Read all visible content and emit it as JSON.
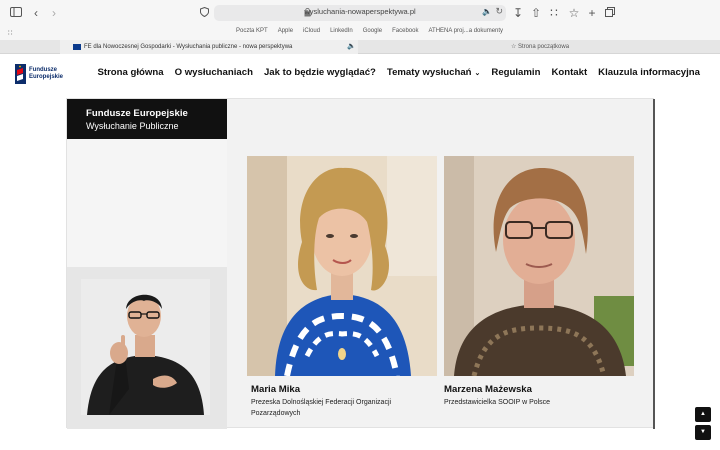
{
  "browser": {
    "url": "wysluchania-nowaperspektywa.pl",
    "favorites": [
      "Poczta KPT",
      "Apple",
      "iCloud",
      "LinkedIn",
      "Google",
      "Facebook",
      "ATHENA proj...a dokumenty"
    ],
    "tabs": [
      {
        "label": "FE dla Nowoczesnej Gospodarki - Wysłuchania publiczne - nowa perspektywa",
        "active": true
      },
      {
        "label": "Strona początkowa",
        "active": false
      }
    ]
  },
  "site": {
    "logo": {
      "line1": "Fundusze",
      "line2": "Europejskie"
    },
    "nav": [
      "Strona główna",
      "O wysłuchaniach",
      "Jak to będzie wyglądać?",
      "Tematy wysłuchań",
      "Regulamin",
      "Kontakt",
      "Klauzula informacyjna"
    ]
  },
  "stage": {
    "title_line1": "Fundusze Europejskie",
    "title_line2": "Wysłuchanie Publiczne",
    "speakers": [
      {
        "name": "Maria Mika",
        "role_line1": "Prezeska Dolnośląskiej Federacji Organizacji",
        "role_line2": "Pozarządowych"
      },
      {
        "name": "Marzena Mażewska",
        "role_line1": "Przedstawicielka SOOIP w Polsce",
        "role_line2": ""
      }
    ]
  },
  "colors": {
    "brand_blue": "#0c2d6b",
    "brand_red": "#e30613",
    "title_box": "#111111"
  }
}
